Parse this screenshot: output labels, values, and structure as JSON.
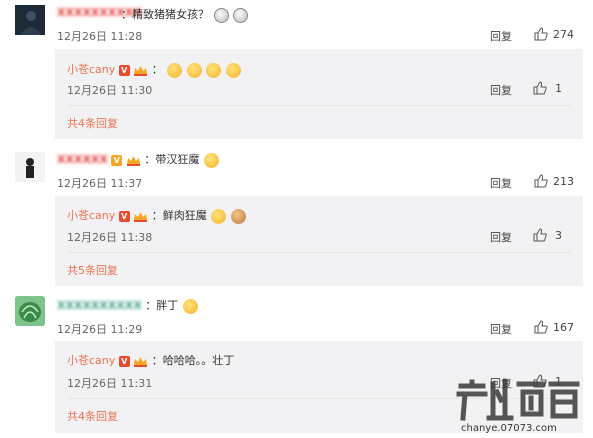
{
  "comments": [
    {
      "text": "：精致猪猪女孩？",
      "time": "12月26日 11:28",
      "reply_label": "回复",
      "likes": "274",
      "reply": {
        "name": "小苍cany",
        "text": "：",
        "time": "12月26日 11:30",
        "reply_label": "回复",
        "likes": "1"
      },
      "more": "共4条回复"
    },
    {
      "text": "：带汉狂魔",
      "time": "12月26日 11:37",
      "reply_label": "回复",
      "likes": "213",
      "reply": {
        "name": "小苍cany",
        "text": "：鲜肉狂魔",
        "time": "12月26日 11:38",
        "reply_label": "回复",
        "likes": "3"
      },
      "more": "共5条回复"
    },
    {
      "text": "：胖丁",
      "time": "12月26日 11:29",
      "reply_label": "回复",
      "likes": "167",
      "reply": {
        "name": "小苍cany",
        "text": "：哈哈哈。。壮丁",
        "time": "12月26日 11:31",
        "reply_label": "回复",
        "likes": "1"
      },
      "more": "共4条回复"
    }
  ],
  "badges": {
    "v": "V"
  },
  "colors": {
    "link": "#eb7350",
    "reply_bg": "#f2f2f5"
  },
  "watermark": {
    "text": "chanye.07073.com"
  }
}
